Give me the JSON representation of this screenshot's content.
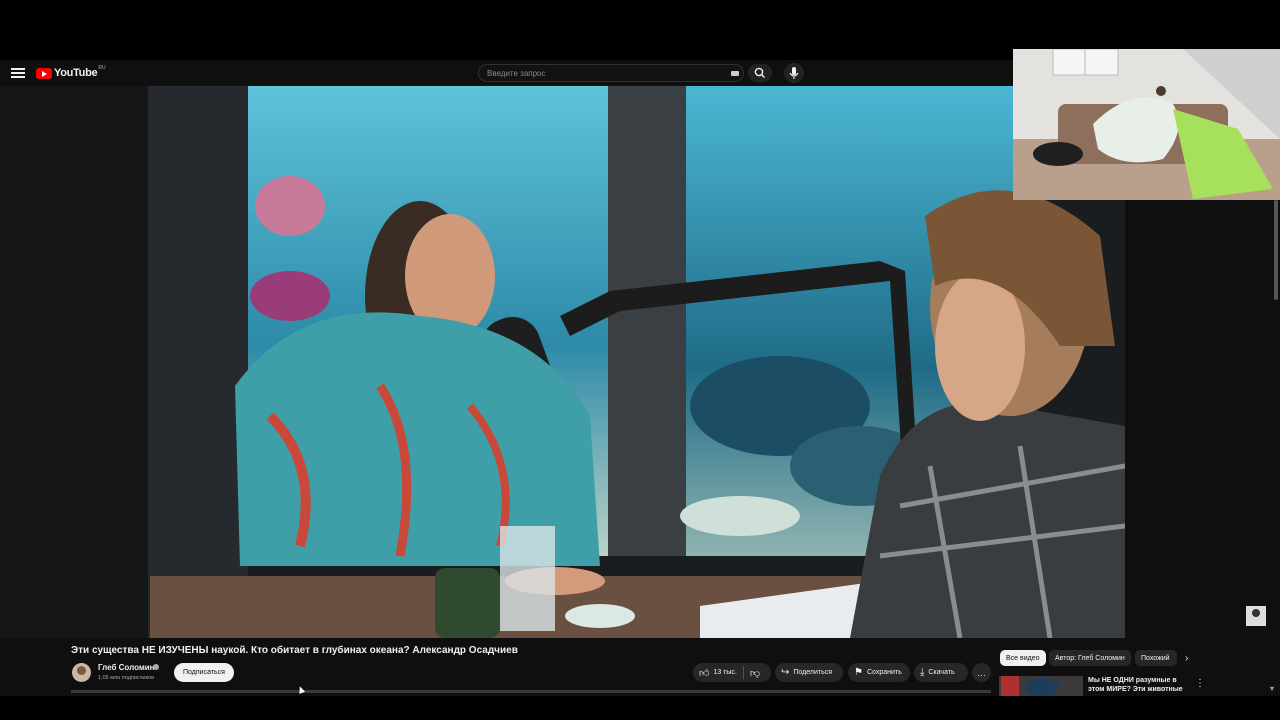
{
  "app": {
    "logo_text": "YouTube",
    "region": "RU"
  },
  "search": {
    "placeholder": "Введите запрос"
  },
  "video": {
    "title": "Эти существа НЕ ИЗУЧЕНЫ наукой. Кто обитает в глубинах океана? Александр Осадчиев"
  },
  "channel": {
    "name": "Глеб Соломин",
    "subscribers": "1,05 млн подписчиков",
    "subscribe_label": "Подписаться"
  },
  "actions": {
    "likes": "13 тыс.",
    "share": "Поделиться",
    "save": "Сохранить",
    "download": "Скачать",
    "more": "…"
  },
  "chips": [
    {
      "label": "Все видео",
      "active": true
    },
    {
      "label": "Автор: Глеб Соломин",
      "active": false
    },
    {
      "label": "Похожий",
      "active": false
    }
  ],
  "recommendation": {
    "title": "Мы НЕ ОДНИ разумные в этом МИРЕ? Эти животные …"
  },
  "icons": {
    "menu": "hamburger-icon",
    "search": "magnifier-icon",
    "mic": "microphone-icon",
    "like": "thumbs-up-icon",
    "dislike": "thumbs-down-icon",
    "share": "share-arrow-icon",
    "save": "bookmark-icon",
    "download": "download-icon"
  },
  "colors": {
    "brand": "#ff0000",
    "background": "#0f0f0f",
    "pill": "#272727"
  }
}
